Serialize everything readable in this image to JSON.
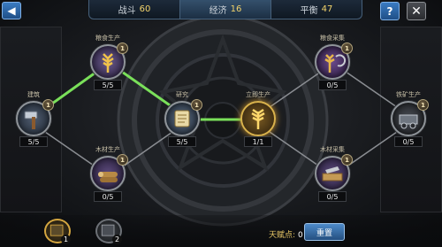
{
  "top_bar": {
    "back_icon": "back-arrow-icon",
    "stats": [
      {
        "label": "战斗",
        "value": "60"
      },
      {
        "label": "经济",
        "value": "16"
      },
      {
        "label": "平衡",
        "value": "47"
      }
    ],
    "help_label": "?",
    "close_label": "✕"
  },
  "nodes": {
    "building": {
      "label": "建筑",
      "level": "1",
      "count": "5/5",
      "icon": "hammer-icon"
    },
    "grain_prod": {
      "label": "粮食生产",
      "level": "1",
      "count": "5/5",
      "icon": "wheat-gold-icon"
    },
    "wood_prod": {
      "label": "木材生产",
      "level": "1",
      "count": "0/5",
      "icon": "wood-logs-icon"
    },
    "research": {
      "label": "研究",
      "level": "1",
      "count": "5/5",
      "icon": "scroll-icon"
    },
    "instant_prod": {
      "label": "立即生产",
      "level": "",
      "count": "1/1",
      "icon": "golden-wheat-icon"
    },
    "grain_gather": {
      "label": "粮食采集",
      "level": "1",
      "count": "0/5",
      "icon": "wheat-purple-icon"
    },
    "wood_gather": {
      "label": "木材采集",
      "level": "1",
      "count": "0/5",
      "icon": "wood-plank-icon"
    },
    "iron_prod": {
      "label": "铁矿生产",
      "level": "1",
      "count": "0/5",
      "icon": "iron-cart-icon"
    }
  },
  "bottom": {
    "tabs": [
      {
        "num": "1",
        "icon": "talent-book-gold-icon"
      },
      {
        "num": "2",
        "icon": "talent-book-grey-icon"
      }
    ],
    "talent_points_label": "天赋点:",
    "talent_points_value": "0",
    "reset_label": "重置"
  },
  "colors": {
    "active_link": "#7ae05a",
    "inactive_link": "#8a8d92",
    "accent_gold": "#e9c867",
    "button_blue": "#3a7bc2"
  }
}
